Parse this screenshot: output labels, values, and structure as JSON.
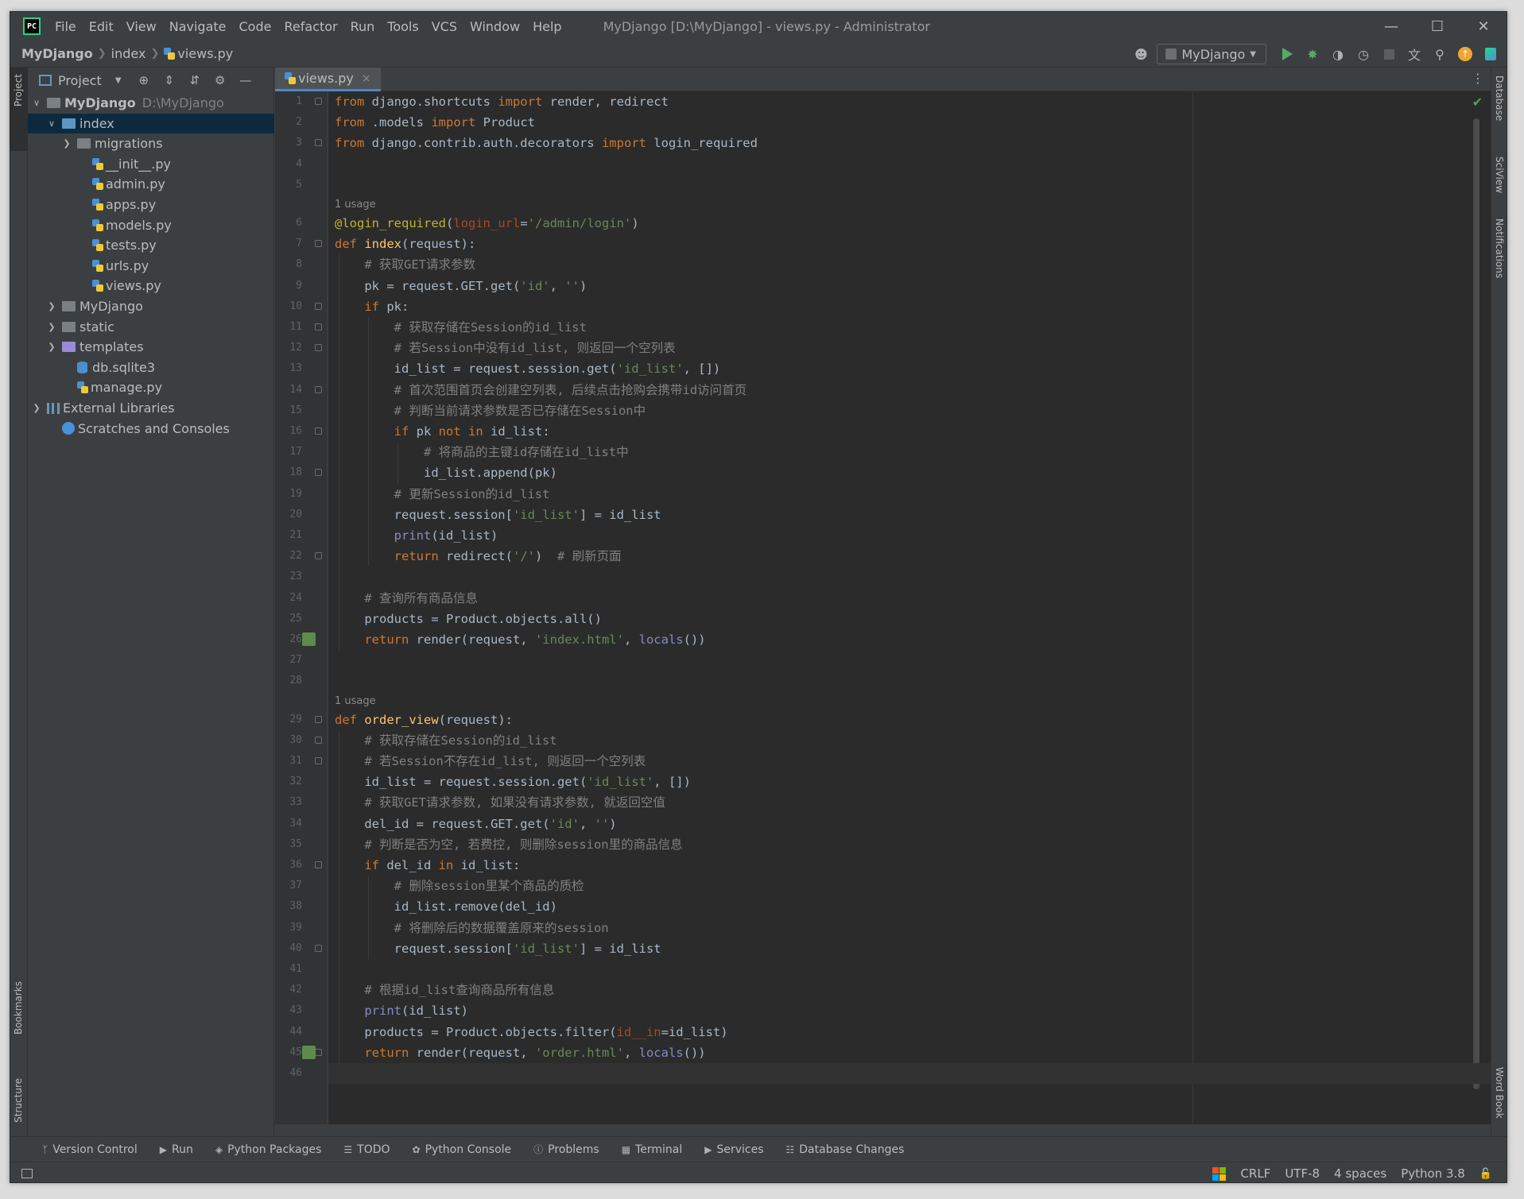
{
  "window": {
    "title": "MyDjango [D:\\MyDjango] - views.py - Administrator",
    "menu": [
      "File",
      "Edit",
      "View",
      "Navigate",
      "Code",
      "Refactor",
      "Run",
      "Tools",
      "VCS",
      "Window",
      "Help"
    ]
  },
  "breadcrumb": [
    "MyDjango",
    "index",
    "views.py"
  ],
  "run_config": "MyDjango",
  "project_panel": {
    "title": "Project",
    "tree": [
      {
        "label": "MyDjango",
        "path": "D:\\MyDjango",
        "depth": 0,
        "expanded": true,
        "icon": "folder"
      },
      {
        "label": "index",
        "depth": 1,
        "expanded": true,
        "icon": "folder",
        "selected": true
      },
      {
        "label": "migrations",
        "depth": 2,
        "expanded": false,
        "icon": "folder"
      },
      {
        "label": "__init__.py",
        "depth": 3,
        "icon": "python-file"
      },
      {
        "label": "admin.py",
        "depth": 3,
        "icon": "python-file"
      },
      {
        "label": "apps.py",
        "depth": 3,
        "icon": "python-file"
      },
      {
        "label": "models.py",
        "depth": 3,
        "icon": "python-file"
      },
      {
        "label": "tests.py",
        "depth": 3,
        "icon": "python-file"
      },
      {
        "label": "urls.py",
        "depth": 3,
        "icon": "python-file"
      },
      {
        "label": "views.py",
        "depth": 3,
        "icon": "python-file"
      },
      {
        "label": "MyDjango",
        "depth": 1,
        "expanded": false,
        "icon": "folder"
      },
      {
        "label": "static",
        "depth": 1,
        "expanded": false,
        "icon": "folder"
      },
      {
        "label": "templates",
        "depth": 1,
        "expanded": false,
        "icon": "folder-purple"
      },
      {
        "label": "db.sqlite3",
        "depth": 2,
        "icon": "database-file"
      },
      {
        "label": "manage.py",
        "depth": 2,
        "icon": "python-file"
      },
      {
        "label": "External Libraries",
        "depth": 0,
        "expanded": false,
        "icon": "library"
      },
      {
        "label": "Scratches and Consoles",
        "depth": 1,
        "icon": "scratches"
      }
    ]
  },
  "editor": {
    "tab": "views.py",
    "usage_hint": "1 usage",
    "lines": [
      "from django.shortcuts import render, redirect",
      "from .models import Product",
      "from django.contrib.auth.decorators import login_required",
      "",
      "",
      "@login_required(login_url='/admin/login')",
      "def index(request):",
      "    # 获取GET请求参数",
      "    pk = request.GET.get('id', '')",
      "    if pk:",
      "        # 获取存储在Session的id_list",
      "        # 若Session中没有id_list, 则返回一个空列表",
      "        id_list = request.session.get('id_list', [])",
      "        # 首次范围首页会创建空列表, 后续点击抢购会携带id访问首页",
      "        # 判断当前请求参数是否已存储在Session中",
      "        if pk not in id_list:",
      "            # 将商品的主键id存储在id_list中",
      "            id_list.append(pk)",
      "        # 更新Session的id_list",
      "        request.session['id_list'] = id_list",
      "        print(id_list)",
      "        return redirect('/')  # 刷新页面",
      "",
      "    # 查询所有商品信息",
      "    products = Product.objects.all()",
      "    return render(request, 'index.html', locals())",
      "",
      "",
      "def order_view(request):",
      "    # 获取存储在Session的id_list",
      "    # 若Session不存在id_list, 则返回一个空列表",
      "    id_list = request.session.get('id_list', [])",
      "    # 获取GET请求参数, 如果没有请求参数, 就返回空值",
      "    del_id = request.GET.get('id', '')",
      "    # 判断是否为空, 若费控, 则删除session里的商品信息",
      "    if del_id in id_list:",
      "        # 删除session里某个商品的质检",
      "        id_list.remove(del_id)",
      "        # 将删除后的数据覆盖原来的session",
      "        request.session['id_list'] = id_list",
      "",
      "    # 根据id_list查询商品所有信息",
      "    print(id_list)",
      "    products = Product.objects.filter(id__in=id_list)",
      "    return render(request, 'order.html', locals())",
      ""
    ]
  },
  "left_stripe": {
    "project": "Project",
    "bookmarks": "Bookmarks",
    "structure": "Structure"
  },
  "right_stripe": {
    "database": "Database",
    "sciview": "SciView",
    "notifications": "Notifications",
    "wordbook": "Word Book"
  },
  "bottom_tools": [
    "Version Control",
    "Run",
    "Python Packages",
    "TODO",
    "Python Console",
    "Problems",
    "Terminal",
    "Services",
    "Database Changes"
  ],
  "status": {
    "line_sep": "CRLF",
    "encoding": "UTF-8",
    "indent": "4 spaces",
    "interpreter": "Python 3.8"
  },
  "colors": {
    "editor_bg": "#2b2b2b",
    "panel_bg": "#3c3f41",
    "keyword": "#cc7832",
    "string": "#6a8759",
    "comment": "#808080",
    "function": "#ffc66d",
    "selection": "#0d293e"
  }
}
